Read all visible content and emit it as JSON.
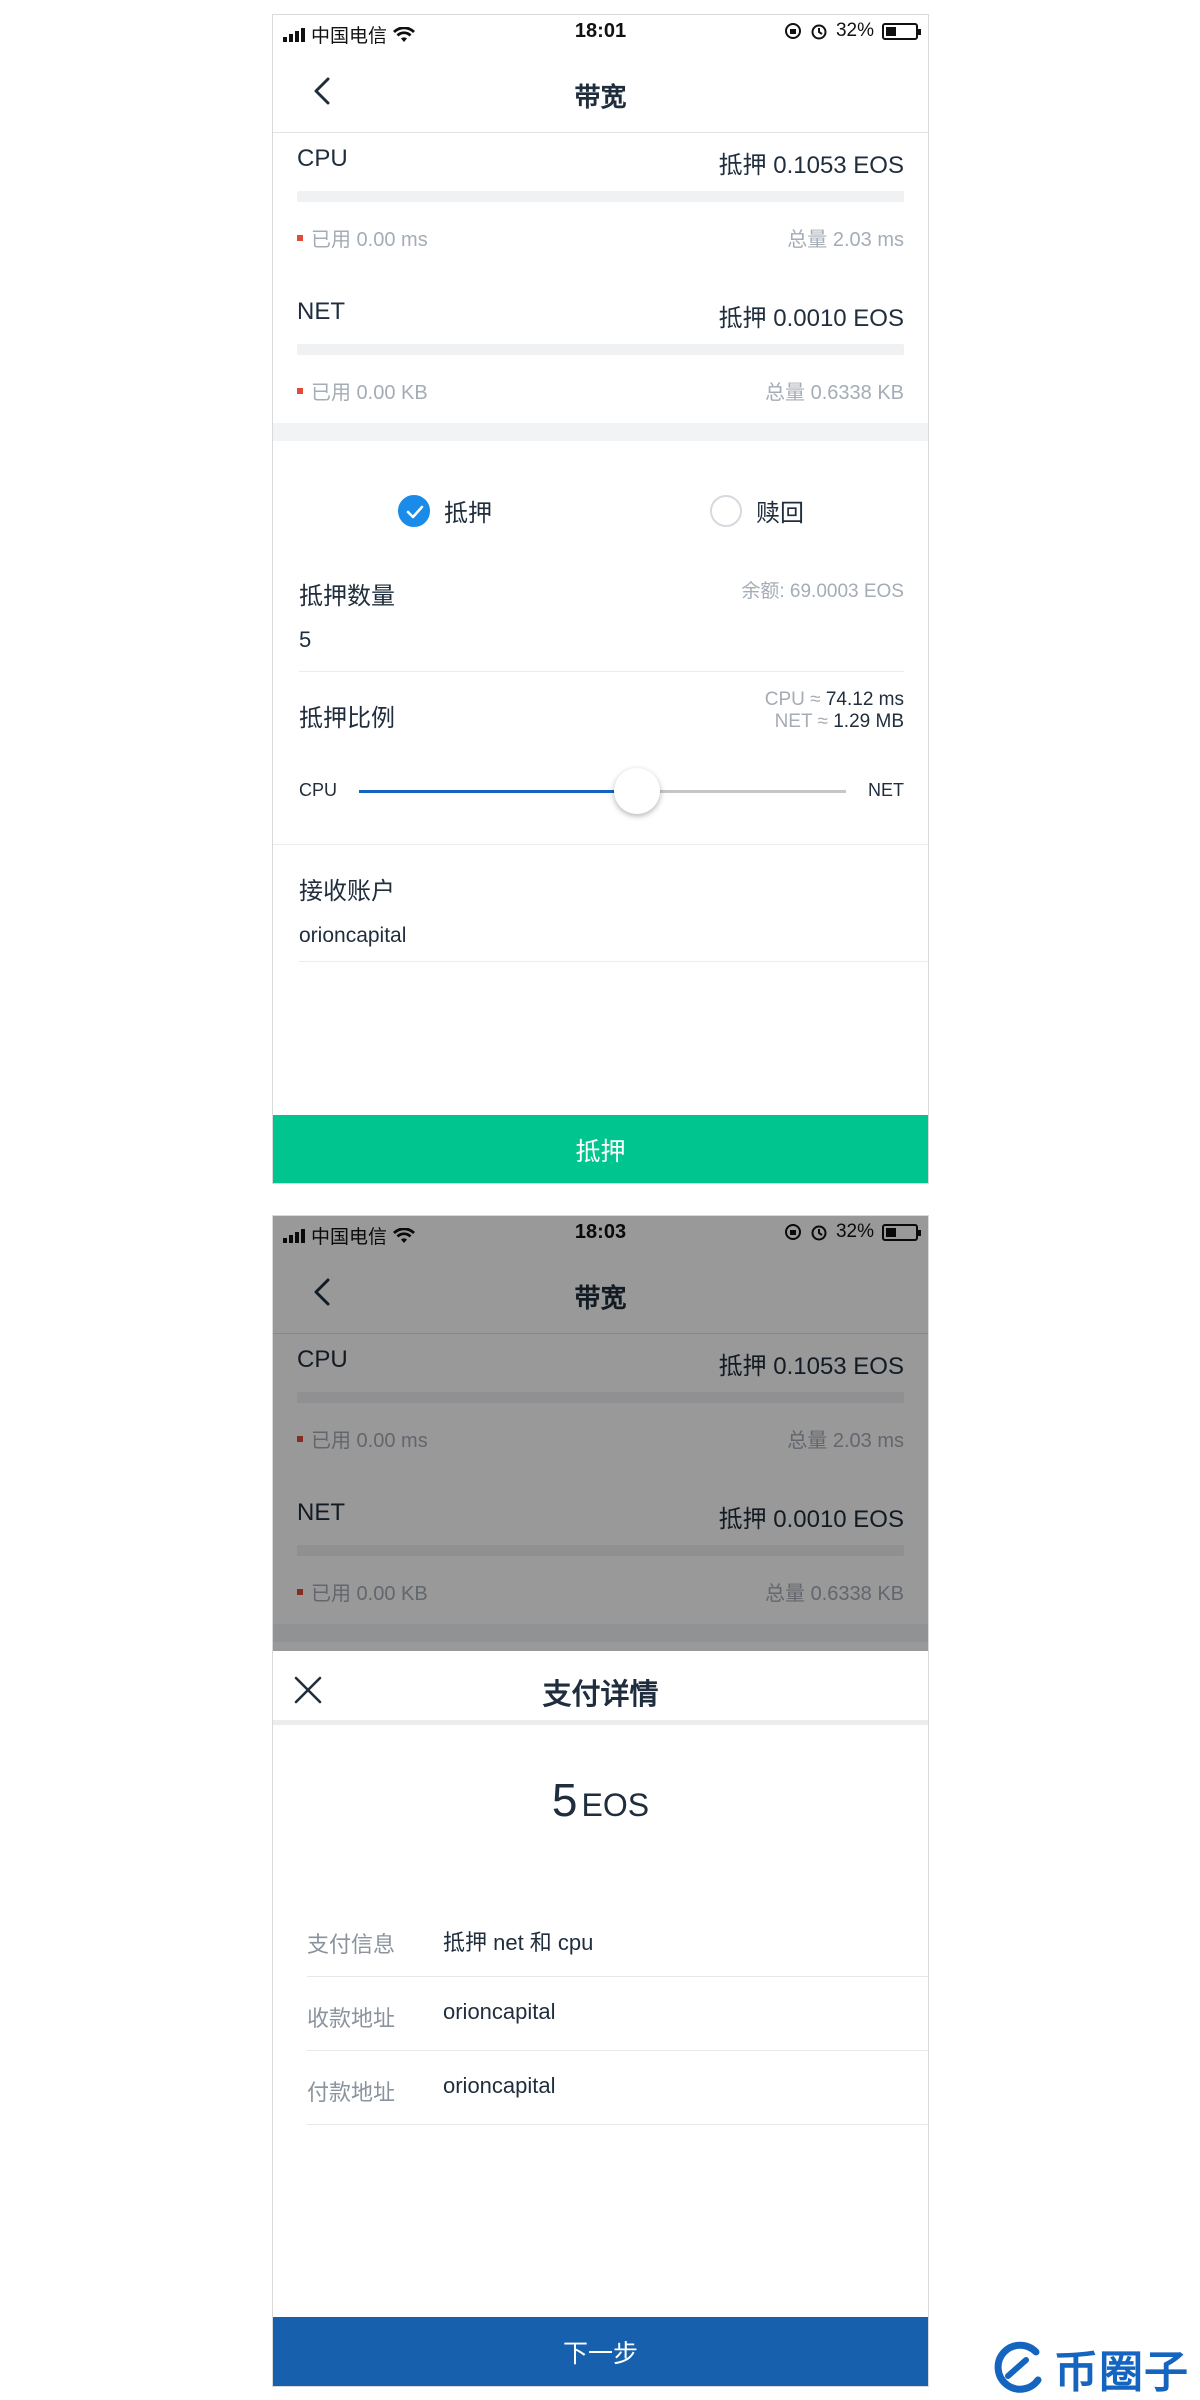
{
  "colors": {
    "accent_blue": "#1a8be8",
    "green_button": "#00c58e",
    "blue_button": "#1760ad",
    "used_dot": "#e04b3a"
  },
  "screen1": {
    "status": {
      "carrier": "中国电信",
      "time": "18:01",
      "battery": "32%"
    },
    "nav": {
      "title": "带宽",
      "back_icon": "chevron-left-icon"
    },
    "cpu": {
      "name": "CPU",
      "stake": "抵押 0.1053 EOS",
      "used": "已用 0.00 ms",
      "total": "总量 2.03 ms"
    },
    "net": {
      "name": "NET",
      "stake": "抵押 0.0010 EOS",
      "used": "已用 0.00 KB",
      "total": "总量 0.6338 KB"
    },
    "mode": {
      "stake_label": "抵押",
      "redeem_label": "赎回",
      "selected": "stake"
    },
    "amount": {
      "label": "抵押数量",
      "balance": "余额: 69.0003 EOS",
      "value": "5"
    },
    "ratio": {
      "label": "抵押比例",
      "cpu_prefix": "CPU ≈",
      "cpu_value": "74.12 ms",
      "net_prefix": "NET ≈",
      "net_value": "1.29 MB",
      "left_label": "CPU",
      "right_label": "NET",
      "slider_fraction": 0.57
    },
    "receiver": {
      "label": "接收账户",
      "value": "orioncapital"
    },
    "submit_label": "抵押"
  },
  "screen2": {
    "status": {
      "carrier": "中国电信",
      "time": "18:03",
      "battery": "32%"
    },
    "nav": {
      "title": "带宽"
    },
    "cpu": {
      "name": "CPU",
      "stake": "抵押 0.1053 EOS",
      "used": "已用 0.00 ms",
      "total": "总量 2.03 ms"
    },
    "net": {
      "name": "NET",
      "stake": "抵押 0.0010 EOS",
      "used": "已用 0.00 KB",
      "total": "总量 0.6338 KB"
    },
    "sheet": {
      "title": "支付详情",
      "amount": "5",
      "unit": "EOS",
      "rows": [
        {
          "key": "支付信息",
          "value": "抵押 net 和 cpu"
        },
        {
          "key": "收款地址",
          "value": "orioncapital"
        },
        {
          "key": "付款地址",
          "value": "orioncapital"
        }
      ],
      "next_label": "下一步"
    }
  },
  "watermark": {
    "text": "币圈子"
  }
}
